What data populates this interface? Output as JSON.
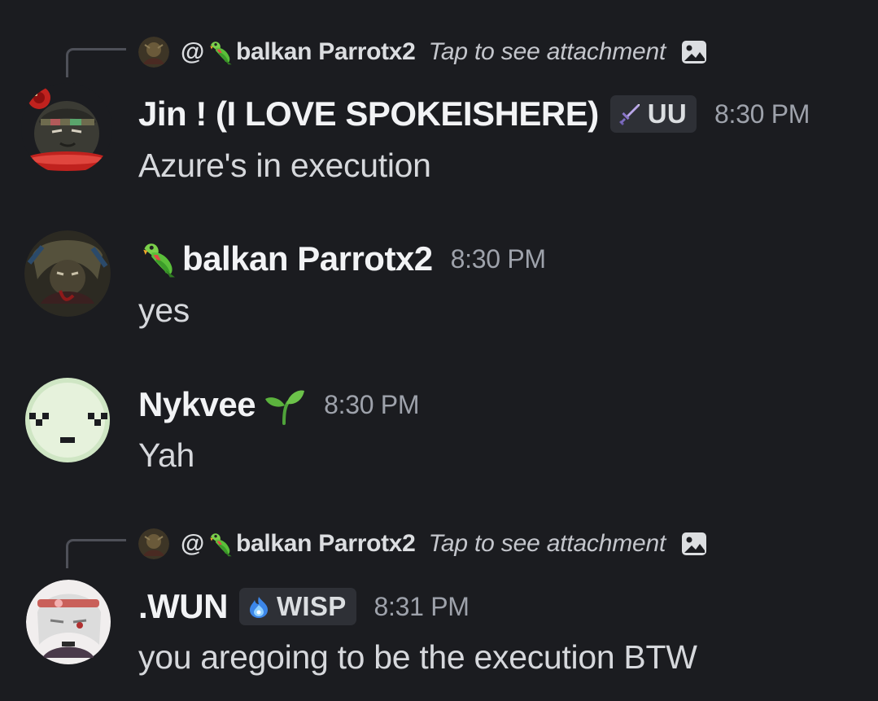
{
  "messages": [
    {
      "reply": {
        "at": "@",
        "name": "balkan Parrotx2",
        "text": "Tap to see attachment",
        "avatar_icon": "parrot-avatar",
        "name_icon": "parrot-emoji",
        "attachment_icon": "image-icon"
      },
      "author": "Jin ! (I LOVE SPOKEISHERE)",
      "tag": {
        "label": "UU",
        "icon": "sword-icon"
      },
      "timestamp": "8:30 PM",
      "content": "Azure's in execution"
    },
    {
      "author": "balkan Parrotx2",
      "author_icon": "parrot-emoji",
      "timestamp": "8:30 PM",
      "content": "yes"
    },
    {
      "author": "Nykvee",
      "author_icon": "seedling-emoji",
      "timestamp": "8:30 PM",
      "content": "Yah"
    },
    {
      "reply": {
        "at": "@",
        "name": "balkan Parrotx2",
        "text": "Tap to see attachment",
        "avatar_icon": "parrot-avatar",
        "name_icon": "parrot-emoji",
        "attachment_icon": "image-icon"
      },
      "author": ".WUN",
      "tag": {
        "label": "WISP",
        "icon": "wisp-flame-icon"
      },
      "timestamp": "8:31 PM",
      "content": "you aregoing to be the execution BTW"
    }
  ],
  "colors": {
    "background": "#1b1c20",
    "text": "#f2f3f5",
    "muted": "#9ea2ab",
    "tag_bg": "#2e3036",
    "reply_line": "#4e5058"
  }
}
